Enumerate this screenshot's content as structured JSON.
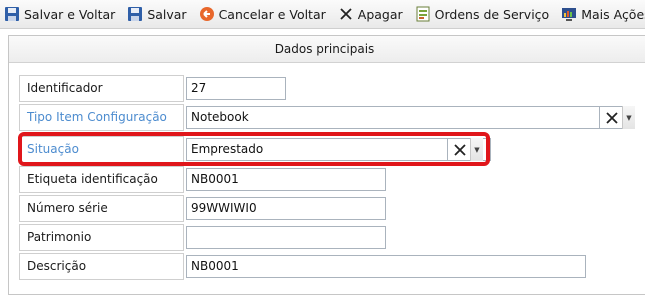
{
  "toolbar": {
    "save_and_back": "Salvar e Voltar",
    "save": "Salvar",
    "cancel_and_back": "Cancelar e Voltar",
    "delete": "Apagar",
    "service_orders": "Ordens de Serviço",
    "more_actions": "Mais Ações"
  },
  "panel": {
    "title": "Dados principais"
  },
  "form": {
    "identificador": {
      "label": "Identificador",
      "value": "27"
    },
    "tipo_item": {
      "label": "Tipo Item Configuração",
      "value": "Notebook"
    },
    "situacao": {
      "label": "Situação",
      "value": "Emprestado"
    },
    "etiqueta": {
      "label": "Etiqueta identificação",
      "value": "NB0001"
    },
    "numero_serie": {
      "label": "Número série",
      "value": "99WWIWI0"
    },
    "patrimonio": {
      "label": "Patrimonio",
      "value": ""
    },
    "descricao": {
      "label": "Descrição",
      "value": "NB0001"
    }
  },
  "colors": {
    "link_label": "#4d8ccf",
    "highlight": "#e0161b"
  },
  "icons": {
    "save_and_back": "floppy-disk-icon",
    "save": "floppy-disk-icon",
    "cancel_and_back": "cancel-circle-icon",
    "delete": "x-icon",
    "service_orders": "document-grid-icon",
    "more_actions": "monitor-chart-icon"
  }
}
